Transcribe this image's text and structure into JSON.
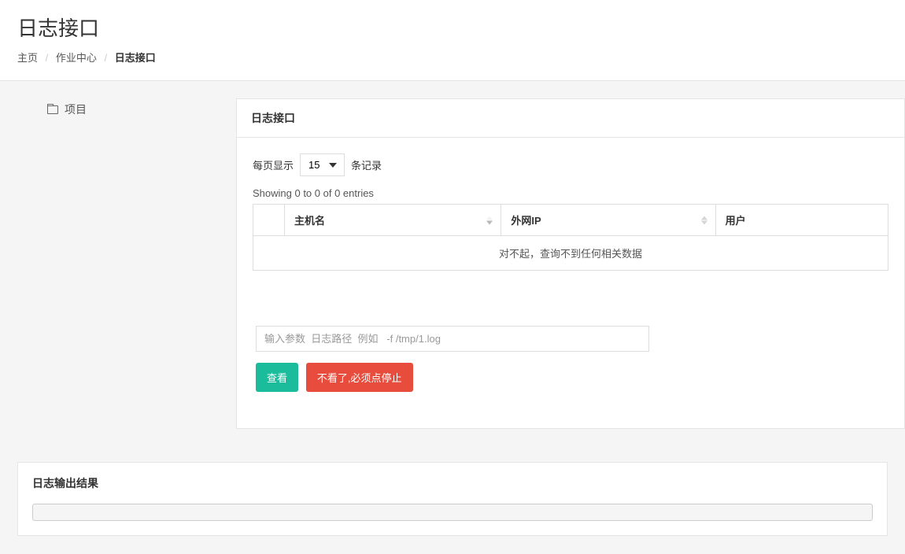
{
  "header": {
    "title": "日志接口",
    "breadcrumb": {
      "home": "主页",
      "mid": "作业中心",
      "active": "日志接口"
    }
  },
  "sidebar": {
    "item0": {
      "label": "项目"
    }
  },
  "panel": {
    "title": "日志接口",
    "length": {
      "prefix": "每页显示",
      "value": "15",
      "suffix": "条记录"
    },
    "info": "Showing 0 to 0 of 0 entries",
    "columns": {
      "host": "主机名",
      "ip": "外网IP",
      "user": "用户"
    },
    "empty": "对不起，查询不到任何相关数据",
    "input_placeholder": "输入参数  日志路径  例如   -f /tmp/1.log",
    "btn_view": "查看",
    "btn_stop": "不看了,必须点停止"
  },
  "output": {
    "title": "日志输出结果"
  }
}
